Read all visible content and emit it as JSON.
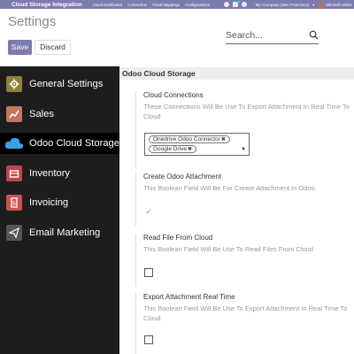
{
  "navbar": {
    "app_name": "Cloud Storage Integration",
    "menu": [
      "Cloud Dashboard",
      "Connection",
      "Cloud Mappings",
      "Configurations"
    ],
    "chat_count": "3",
    "company": "My Company (San Francisco)",
    "user": "Mitchell Admin"
  },
  "control": {
    "title": "Settings",
    "save_label": "Save",
    "discard_label": "Discard",
    "search_placeholder": "Search..."
  },
  "sidebar": {
    "items": [
      {
        "label": "General Settings",
        "icon": "gear-icon",
        "color": "#8e8037"
      },
      {
        "label": "Sales",
        "icon": "chart-icon",
        "color": "#c4745a"
      },
      {
        "label": "Odoo Cloud Storage",
        "icon": "cloud-icon",
        "color": "#3aa1e6"
      },
      {
        "label": "Inventory",
        "icon": "box-icon",
        "color": "#c0464c"
      },
      {
        "label": "Invoicing",
        "icon": "invoice-icon",
        "color": "#c9544e"
      },
      {
        "label": "Email Marketing",
        "icon": "paper-plane-icon",
        "color": "#555555"
      }
    ]
  },
  "main": {
    "section_title": "Odoo Cloud Storage",
    "cloud_connections": {
      "title": "Cloud Connections",
      "help": "These Connections Will Be Use To Export Attachment In Real Time To Cloud",
      "tags": [
        "Onedrive Odoo Connector",
        "Google Drive"
      ]
    },
    "create_attachment": {
      "title": "Create Odoo Attachment",
      "help": "This Boolean Field Will Be For Create Attachment In Odoo.",
      "checked": true
    },
    "read_file": {
      "title": "Read File From Cloud",
      "help": "This Boolean Field Will Be Use To Read Files From Cloud",
      "checked": false
    },
    "export_realtime": {
      "title": "Export Attachment Real Time",
      "help": "This Boolean Field Will Be Use To Export Attachment In Real Time To Cloud",
      "checked": false
    }
  }
}
